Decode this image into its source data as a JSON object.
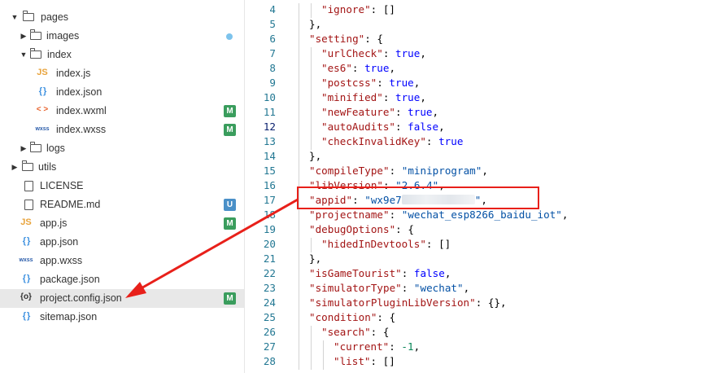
{
  "tree": [
    {
      "label": "pages",
      "type": "folder",
      "state": "open"
    },
    {
      "label": "images",
      "type": "folder",
      "state": "closed",
      "status": "dot"
    },
    {
      "label": "index",
      "type": "folder",
      "state": "open"
    },
    {
      "label": "index.js",
      "type": "js"
    },
    {
      "label": "index.json",
      "type": "json"
    },
    {
      "label": "index.wxml",
      "type": "wxml",
      "status": "M"
    },
    {
      "label": "index.wxss",
      "type": "wxss",
      "status": "M"
    },
    {
      "label": "logs",
      "type": "folder",
      "state": "closed"
    },
    {
      "label": "utils",
      "type": "folder",
      "state": "closed"
    },
    {
      "label": "LICENSE",
      "type": "file"
    },
    {
      "label": "README.md",
      "type": "file",
      "status": "U"
    },
    {
      "label": "app.js",
      "type": "js",
      "status": "M"
    },
    {
      "label": "app.json",
      "type": "json"
    },
    {
      "label": "app.wxss",
      "type": "wxss"
    },
    {
      "label": "package.json",
      "type": "json"
    },
    {
      "label": "project.config.json",
      "type": "config",
      "status": "M",
      "selected": true
    },
    {
      "label": "sitemap.json",
      "type": "json"
    }
  ],
  "icons": {
    "js": "JS",
    "json": "{ }",
    "wxml": "< >",
    "wxss": "wxss",
    "config": "{o}"
  },
  "editor": {
    "active_line": 12,
    "lines": [
      {
        "n": 4,
        "t": "\"ignore\": []"
      },
      {
        "n": 5,
        "t": "},"
      },
      {
        "n": 6,
        "t": "\"setting\": {"
      },
      {
        "n": 7,
        "t": "\"urlCheck\": true,"
      },
      {
        "n": 8,
        "t": "\"es6\": true,"
      },
      {
        "n": 9,
        "t": "\"postcss\": true,"
      },
      {
        "n": 10,
        "t": "\"minified\": true,"
      },
      {
        "n": 11,
        "t": "\"newFeature\": true,"
      },
      {
        "n": 12,
        "t": "\"autoAudits\": false,"
      },
      {
        "n": 13,
        "t": "\"checkInvalidKey\": true"
      },
      {
        "n": 14,
        "t": "},"
      },
      {
        "n": 15,
        "t": "\"compileType\": \"miniprogram\","
      },
      {
        "n": 16,
        "t": "\"libVersion\": \"2.6.4\","
      },
      {
        "n": 17,
        "t": "\"appid\": \"wx9e7\","
      },
      {
        "n": 18,
        "t": "\"projectname\": \"wechat_esp8266_baidu_iot\","
      },
      {
        "n": 19,
        "t": "\"debugOptions\": {"
      },
      {
        "n": 20,
        "t": "\"hidedInDevtools\": []"
      },
      {
        "n": 21,
        "t": "},"
      },
      {
        "n": 22,
        "t": "\"isGameTourist\": false,"
      },
      {
        "n": 23,
        "t": "\"simulatorType\": \"wechat\","
      },
      {
        "n": 24,
        "t": "\"simulatorPluginLibVersion\": {},"
      },
      {
        "n": 25,
        "t": "\"condition\": {"
      },
      {
        "n": 26,
        "t": "\"search\": {"
      },
      {
        "n": 27,
        "t": "\"current\": -1,"
      },
      {
        "n": 28,
        "t": "\"list\": []"
      }
    ]
  },
  "colors": {
    "highlight": "#e8201a",
    "modified_badge": "#3a9d5d",
    "untracked_badge": "#4a90c8",
    "status_dot": "#7dc3ec"
  }
}
